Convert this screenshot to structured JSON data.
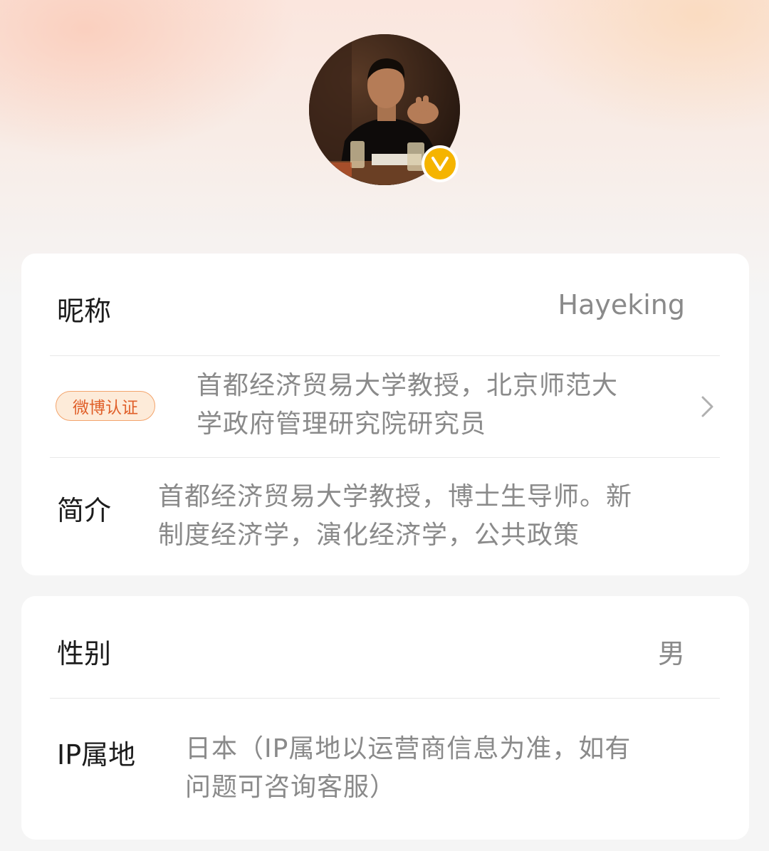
{
  "profile": {
    "avatar_alt": "avatar",
    "verified_icon": "verified-v-icon",
    "verified_letter": "V"
  },
  "card1": {
    "nickname_label": "昵称",
    "nickname_value": "Hayeking",
    "cert_chip": "微博认证",
    "cert_line1": "首都经济贸易大学教授，北京师范大",
    "cert_line2": "学政府管理研究院研究员",
    "intro_label": "简介",
    "intro_line1": "首都经济贸易大学教授，博士生导师。新",
    "intro_line2": "制度经济学，演化经济学，公共政策"
  },
  "card2": {
    "gender_label": "性别",
    "gender_value": "男",
    "ip_label": "IP属地",
    "ip_line1": "日本（IP属地以运营商信息为准，如有",
    "ip_line2": "问题可咨询客服）"
  },
  "colors": {
    "badge": "#f5b400",
    "chip_text": "#e0602a",
    "chip_border": "#f3a46c"
  }
}
